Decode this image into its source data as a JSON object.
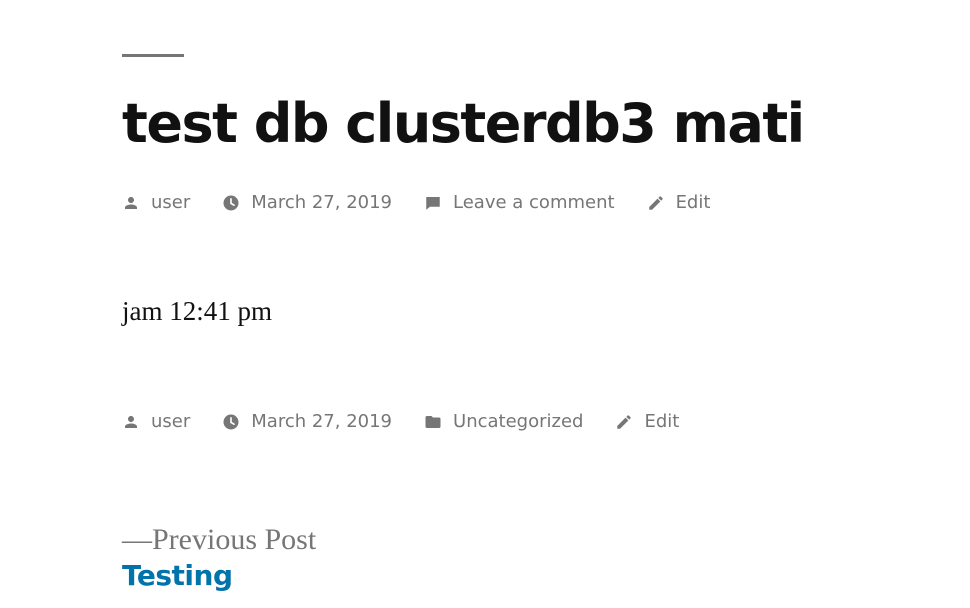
{
  "post": {
    "title": "test db clusterdb3 mati",
    "body": "jam 12:41 pm"
  },
  "meta_top": {
    "author": "user",
    "date": "March 27, 2019",
    "comments": "Leave a comment",
    "edit": "Edit"
  },
  "meta_bottom": {
    "author": "user",
    "date": "March 27, 2019",
    "category": "Uncategorized",
    "edit": "Edit"
  },
  "navigation": {
    "previous_label": "—Previous Post",
    "previous_title": "Testing"
  },
  "colors": {
    "meta": "#767676",
    "link": "#0073aa",
    "text": "#111111"
  },
  "icons": {
    "author": "person-icon",
    "date": "clock-icon",
    "comments": "comment-icon",
    "category": "folder-icon",
    "edit": "pencil-icon"
  }
}
